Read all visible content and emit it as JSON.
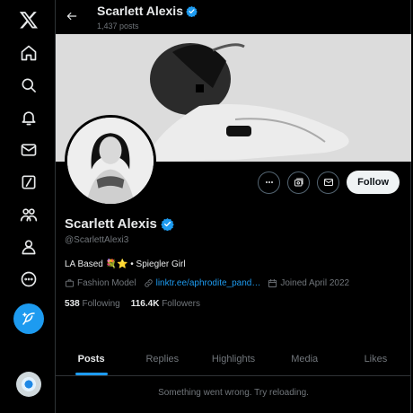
{
  "nav": {
    "items": [
      {
        "name": "x-logo-icon"
      },
      {
        "name": "home-icon"
      },
      {
        "name": "search-icon"
      },
      {
        "name": "notifications-icon"
      },
      {
        "name": "messages-icon"
      },
      {
        "name": "grok-icon"
      },
      {
        "name": "communities-icon"
      },
      {
        "name": "profile-icon"
      },
      {
        "name": "more-icon"
      }
    ],
    "post_icon": "feather-plus-icon"
  },
  "header": {
    "back_icon": "arrow-left-icon",
    "name": "Scarlett Alexis",
    "post_count": "1,437 posts"
  },
  "profile": {
    "name": "Scarlett Alexis",
    "handle": "@ScarlettAlexi3",
    "bio": "LA Based 💐⭐ • Spiegler Girl",
    "category": "Fashion Model",
    "link": "linktr.ee/aphrodite_pand…",
    "joined": "Joined April 2022",
    "following_count": "538",
    "following_label": "Following",
    "followers_count": "116.4K",
    "followers_label": "Followers",
    "verified_color": "#1d9bf0"
  },
  "actions": {
    "more_icon": "ellipsis-icon",
    "subscribe_icon": "subscribe-icon",
    "message_icon": "envelope-icon",
    "follow_label": "Follow"
  },
  "tabs": [
    "Posts",
    "Replies",
    "Highlights",
    "Media",
    "Likes"
  ],
  "active_tab": "Posts",
  "error_message": "Something went wrong. Try reloading.",
  "colors": {
    "background": "#000000",
    "accent": "#1d9bf0",
    "muted_text": "#71767b",
    "primary_text": "#e7e9ea"
  }
}
